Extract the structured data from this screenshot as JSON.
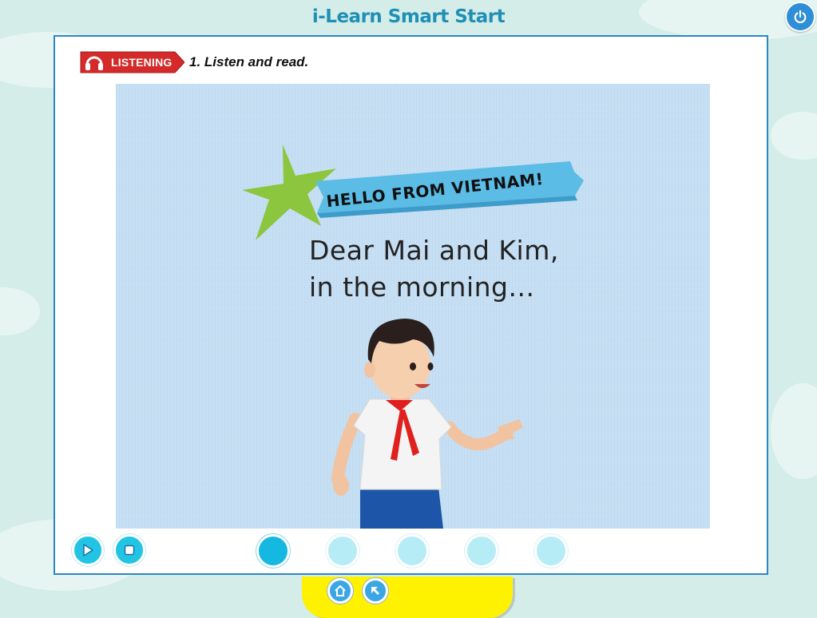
{
  "app": {
    "title": "i-Learn Smart Start"
  },
  "header": {
    "power_icon": "power-icon"
  },
  "activity": {
    "badge_label": "LISTENING",
    "badge_icon": "headphones-icon",
    "instruction": "1. Listen and read."
  },
  "story": {
    "heading": "HELLO FROM VIETNAM!",
    "lines": [
      "Dear Mai and Kim,",
      "in the morning..."
    ]
  },
  "controls": {
    "play_icon": "play-icon",
    "stop_icon": "stop-icon",
    "pages": [
      {
        "active": true
      },
      {
        "active": false
      },
      {
        "active": false
      },
      {
        "active": false
      },
      {
        "active": false
      }
    ]
  },
  "dock": {
    "home_icon": "home-icon",
    "back_icon": "back-arrow-icon"
  },
  "colors": {
    "background": "#d4ede8",
    "panel_border": "#2b86c5",
    "accent_cyan": "#22c4e4",
    "badge_red": "#d42a2a",
    "dock_yellow": "#fff200",
    "banner_blue": "#5bbce6",
    "star_green": "#8cc63f"
  }
}
